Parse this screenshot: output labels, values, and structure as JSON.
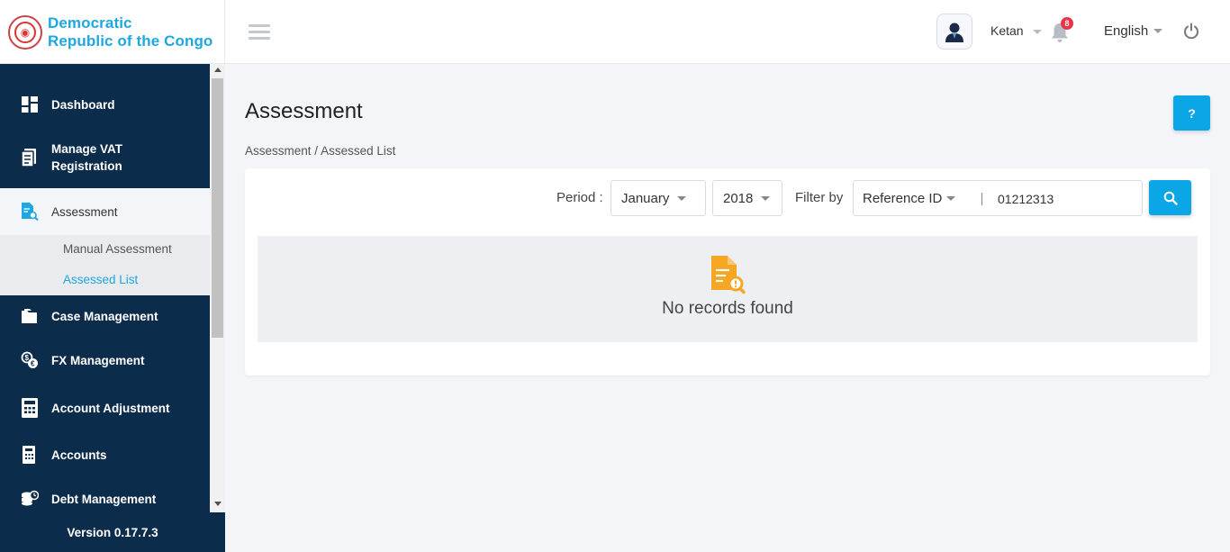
{
  "brand": {
    "line1": "Democratic",
    "line2": "Republic of the Congo"
  },
  "header": {
    "user_name": "Ketan",
    "notification_count": "8",
    "language": "English"
  },
  "sidebar": {
    "items": [
      {
        "label": "Dashboard",
        "icon": "dashboard-icon"
      },
      {
        "label": "Manage VAT Registration",
        "icon": "vat-registration-icon"
      },
      {
        "label": "Assessment",
        "icon": "assessment-icon",
        "active": true
      },
      {
        "label": "Case Management",
        "icon": "folder-icon"
      },
      {
        "label": "FX Management",
        "icon": "fx-icon"
      },
      {
        "label": "Account Adjustment",
        "icon": "calculator-icon"
      },
      {
        "label": "Accounts",
        "icon": "accounts-icon"
      },
      {
        "label": "Debt Management",
        "icon": "debt-icon"
      }
    ],
    "sub_items": [
      {
        "label": "Manual Assessment"
      },
      {
        "label": "Assessed List",
        "selected": true
      }
    ],
    "version": "Version 0.17.7.3"
  },
  "page": {
    "title": "Assessment",
    "help_label": "?",
    "breadcrumb": {
      "parent": "Assessment",
      "separator": "/",
      "current": "Assessed List"
    }
  },
  "filters": {
    "period_label": "Period :",
    "month": "January",
    "year": "2018",
    "filter_by_label": "Filter by",
    "filter_type": "Reference ID",
    "filter_value": "01212313"
  },
  "results": {
    "empty_message": "No records found"
  },
  "colors": {
    "sidebar_bg": "#0c2c4b",
    "accent": "#0aa6e6",
    "brand_text": "#1ea7e0",
    "badge": "#e8334a",
    "empty_icon": "#f5a623"
  }
}
